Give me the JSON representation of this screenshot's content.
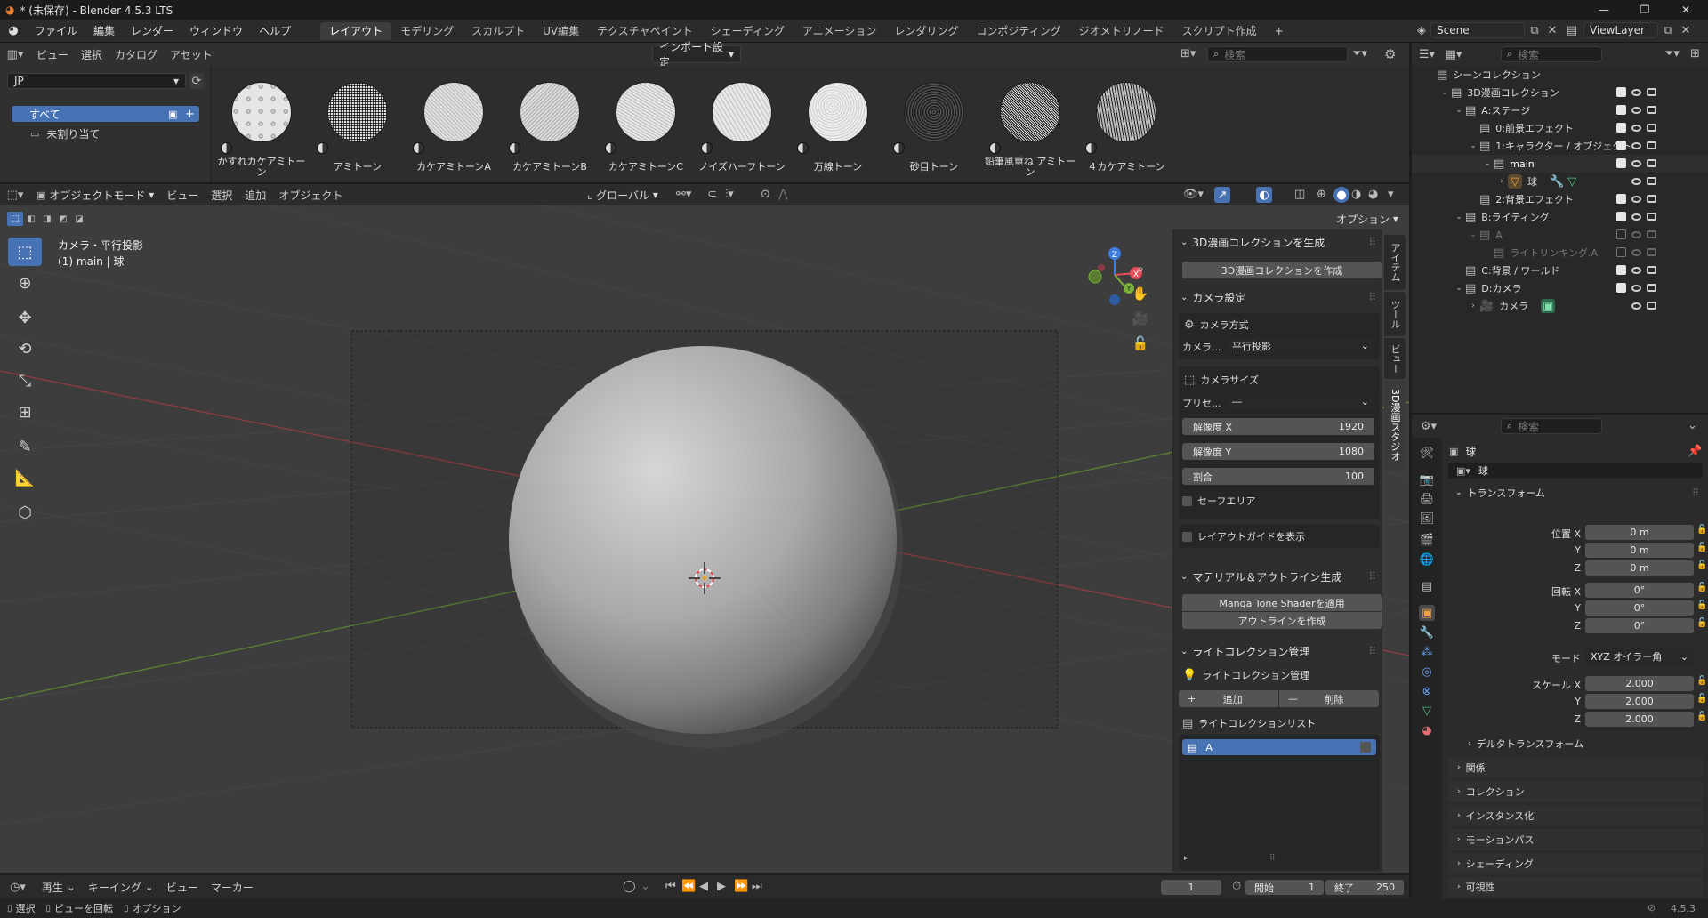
{
  "window": {
    "title": "* (未保存) - Blender 4.5.3 LTS"
  },
  "topbar": {
    "menus": [
      "ファイル",
      "編集",
      "レンダー",
      "ウィンドウ",
      "ヘルプ"
    ],
    "workspaces": [
      "レイアウト",
      "モデリング",
      "スカルプト",
      "UV編集",
      "テクスチャペイント",
      "シェーディング",
      "アニメーション",
      "レンダリング",
      "コンポジティング",
      "ジオメトリノード",
      "スクリプト作成"
    ],
    "scene": "Scene",
    "viewlayer": "ViewLayer"
  },
  "asset_browser": {
    "menus": [
      "ビュー",
      "選択",
      "カタログ",
      "アセット"
    ],
    "import_setting": "インポート設定",
    "search_placeholder": "検索",
    "library": "JP",
    "catalogs": [
      "すべて",
      "未割り当て"
    ],
    "assets": [
      "かすれカケアミトーン",
      "アミトーン",
      "カケアミトーンA",
      "カケアミトーンB",
      "カケアミトーンC",
      "ノイズハーフトーン",
      "万線トーン",
      "砂目トーン",
      "鉛筆風重ね アミトーン",
      "４カケアミトーン"
    ]
  },
  "viewport": {
    "mode": "オブジェクトモード",
    "menus": [
      "ビュー",
      "選択",
      "追加",
      "オブジェクト"
    ],
    "orientation": "グローバル",
    "options": "オプション",
    "overlay_line1": "カメラ・平行投影",
    "overlay_line2": "(1) main | 球"
  },
  "npanel": {
    "tabs": [
      "アイテム",
      "ツール",
      "ビュー",
      "3D漫画スタジオ"
    ],
    "sec1_title": "3D漫画コレクションを生成",
    "sec1_button": "3D漫画コレクションを作成",
    "sec2_title": "カメラ設定",
    "camera_method_label": "カメラ方式",
    "camera_label": "カメラ...",
    "camera_value": "平行投影",
    "camera_size_label": "カメラサイズ",
    "preset_label": "プリセ...",
    "preset_value": "―",
    "res_x_label": "解像度 X",
    "res_x_value": "1920",
    "res_y_label": "解像度 Y",
    "res_y_value": "1080",
    "ratio_label": "割合",
    "ratio_value": "100",
    "safe_area": "セーフエリア",
    "layout_guide": "レイアウトガイドを表示",
    "sec3_title": "マテリアル＆アウトライン生成",
    "sec3_btn1": "Manga Tone Shaderを適用",
    "sec3_btn2": "アウトラインを作成",
    "sec4_title": "ライトコレクション管理",
    "sec4_sub": "ライトコレクション管理",
    "add": "追加",
    "remove": "削除",
    "list_title": "ライトコレクションリスト",
    "list_item": "A"
  },
  "outliner": {
    "search_placeholder": "検索",
    "rows": [
      {
        "label": "シーンコレクション",
        "indent": 0
      },
      {
        "label": "3D漫画コレクション",
        "indent": 1
      },
      {
        "label": "A:ステージ",
        "indent": 2
      },
      {
        "label": "0:前景エフェクト",
        "indent": 3
      },
      {
        "label": "1:キャラクター / オブジェクト",
        "indent": 3
      },
      {
        "label": "main",
        "indent": 4
      },
      {
        "label": "球",
        "indent": 5
      },
      {
        "label": "2:背景エフェクト",
        "indent": 3
      },
      {
        "label": "B:ライティング",
        "indent": 2
      },
      {
        "label": "A",
        "indent": 3
      },
      {
        "label": "ライトリンキング.A",
        "indent": 4
      },
      {
        "label": "C:背景 / ワールド",
        "indent": 2
      },
      {
        "label": "D:カメラ",
        "indent": 2
      },
      {
        "label": "カメラ",
        "indent": 3
      }
    ]
  },
  "properties": {
    "search_placeholder": "検索",
    "object_name": "球",
    "object_name_field": "球",
    "transform": "トランスフォーム",
    "location_label": "位置 X",
    "rotation_label": "回転 X",
    "scale_label": "スケール X",
    "y": "Y",
    "z": "Z",
    "loc": [
      "0 m",
      "0 m",
      "0 m"
    ],
    "rot": [
      "0°",
      "0°",
      "0°"
    ],
    "mode_label": "モード",
    "mode_value": "XYZ オイラー角",
    "scale": [
      "2.000",
      "2.000",
      "2.000"
    ],
    "delta": "デルタトランスフォーム",
    "panels": [
      "関係",
      "コレクション",
      "インスタンス化",
      "モーションパス",
      "シェーディング",
      "可視性"
    ]
  },
  "timeline": {
    "menus": [
      "再生",
      "キーイング",
      "ビュー",
      "マーカー"
    ],
    "current_frame": "1",
    "start_label": "開始",
    "start_value": "1",
    "end_label": "終了",
    "end_value": "250"
  },
  "status": {
    "items": [
      "選択",
      "ビューを回転",
      "オプション"
    ],
    "version": "4.5.3"
  },
  "colors": {
    "accent": "#4772b3",
    "x_axis": "#e64d5a",
    "y_axis": "#7ab33a",
    "z_axis": "#3f7de0"
  }
}
